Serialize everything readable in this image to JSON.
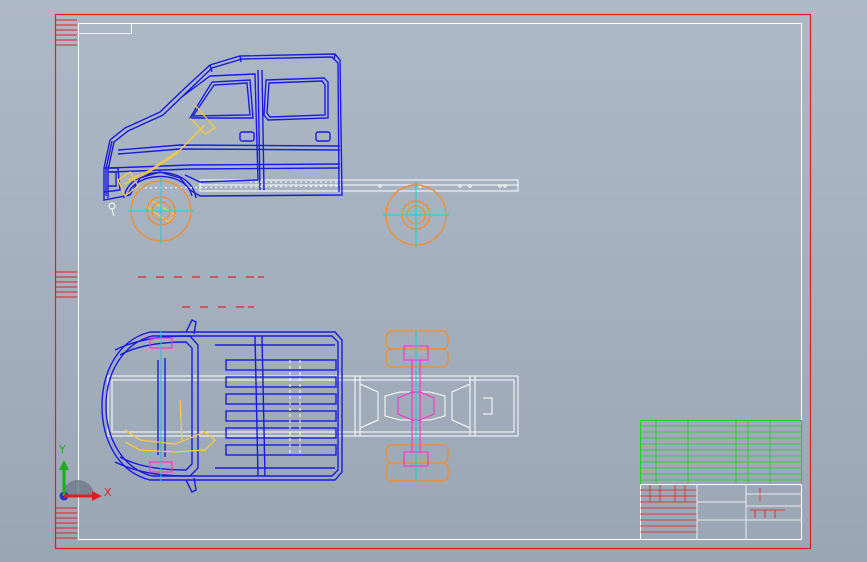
{
  "drawing": {
    "frame_color": "#e02020",
    "views": [
      "side-view",
      "top-view"
    ],
    "title_block": {
      "green_table_rows": 11,
      "red_table_rows": 8
    }
  },
  "axes_triad": {
    "x_label": "X",
    "y_label": "Y",
    "x_color": "#e02020",
    "y_color": "#1faa1f",
    "z_color": "#2233cc"
  },
  "colors": {
    "body_lines": "#1a1ae6",
    "chassis_lines": "#ffffff",
    "wheels": "#ff8a1e",
    "axle_marks": "#ff33cc",
    "center_marks": "#19d3d3",
    "steering": "#ffcc33",
    "title_grid": "#22cc22"
  }
}
